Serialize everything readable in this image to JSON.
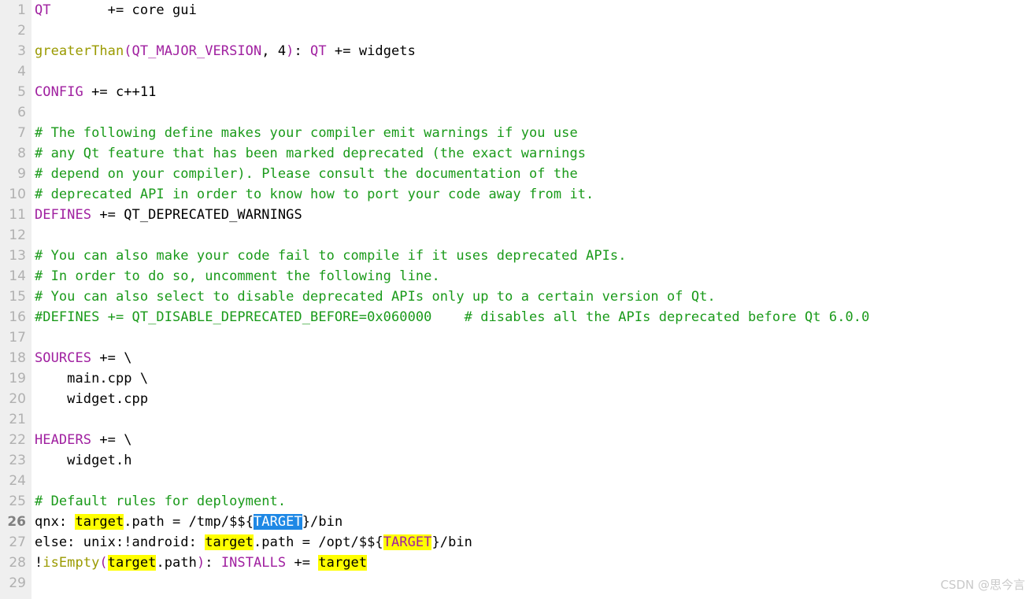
{
  "editor": {
    "language": "qmake-project",
    "colors": {
      "background": "#ffffff",
      "gutter_background": "#efefef",
      "line_number": "#b0b0b0",
      "line_number_current": "#808080",
      "text": "#000000",
      "comment": "#1a9a1a",
      "keyword": "#a020a0",
      "function": "#9a9a00",
      "find_highlight": "#ffff00",
      "selection_highlight": "#1e88e5",
      "selection_text": "#ffffff"
    },
    "current_line": 26,
    "selected_text": "TARGET",
    "find_term": "target",
    "lines": [
      {
        "n": "1",
        "tokens": [
          {
            "t": "QT",
            "c": "keyword"
          },
          {
            "t": "       += core gui",
            "c": "plain"
          }
        ]
      },
      {
        "n": "2",
        "tokens": [
          {
            "t": "",
            "c": "plain"
          }
        ]
      },
      {
        "n": "3",
        "tokens": [
          {
            "t": "greaterThan",
            "c": "func"
          },
          {
            "t": "(",
            "c": "punct"
          },
          {
            "t": "QT_MAJOR_VERSION",
            "c": "keyword"
          },
          {
            "t": ", 4",
            "c": "plain"
          },
          {
            "t": ")",
            "c": "punct"
          },
          {
            "t": ": ",
            "c": "plain"
          },
          {
            "t": "QT",
            "c": "keyword"
          },
          {
            "t": " += widgets",
            "c": "plain"
          }
        ]
      },
      {
        "n": "4",
        "tokens": [
          {
            "t": "",
            "c": "plain"
          }
        ]
      },
      {
        "n": "5",
        "tokens": [
          {
            "t": "CONFIG",
            "c": "keyword"
          },
          {
            "t": " += c++11",
            "c": "plain"
          }
        ]
      },
      {
        "n": "6",
        "tokens": [
          {
            "t": "",
            "c": "plain"
          }
        ]
      },
      {
        "n": "7",
        "tokens": [
          {
            "t": "# The following define makes your compiler emit warnings if you use",
            "c": "comment"
          }
        ]
      },
      {
        "n": "8",
        "tokens": [
          {
            "t": "# any Qt feature that has been marked deprecated (the exact warnings",
            "c": "comment"
          }
        ]
      },
      {
        "n": "9",
        "tokens": [
          {
            "t": "# depend on your compiler). Please consult the documentation of the",
            "c": "comment"
          }
        ]
      },
      {
        "n": "10",
        "tokens": [
          {
            "t": "# deprecated API in order to know how to port your code away from it.",
            "c": "comment"
          }
        ]
      },
      {
        "n": "11",
        "tokens": [
          {
            "t": "DEFINES",
            "c": "keyword"
          },
          {
            "t": " += QT_DEPRECATED_WARNINGS",
            "c": "plain"
          }
        ]
      },
      {
        "n": "12",
        "tokens": [
          {
            "t": "",
            "c": "plain"
          }
        ]
      },
      {
        "n": "13",
        "tokens": [
          {
            "t": "# You can also make your code fail to compile if it uses deprecated APIs.",
            "c": "comment"
          }
        ]
      },
      {
        "n": "14",
        "tokens": [
          {
            "t": "# In order to do so, uncomment the following line.",
            "c": "comment"
          }
        ]
      },
      {
        "n": "15",
        "tokens": [
          {
            "t": "# You can also select to disable deprecated APIs only up to a certain version of Qt.",
            "c": "comment"
          }
        ]
      },
      {
        "n": "16",
        "tokens": [
          {
            "t": "#DEFINES += QT_DISABLE_DEPRECATED_BEFORE=0x060000    # disables all the APIs deprecated before Qt 6.0.0",
            "c": "comment"
          }
        ]
      },
      {
        "n": "17",
        "tokens": [
          {
            "t": "",
            "c": "plain"
          }
        ]
      },
      {
        "n": "18",
        "tokens": [
          {
            "t": "SOURCES",
            "c": "keyword"
          },
          {
            "t": " += \\",
            "c": "plain"
          }
        ]
      },
      {
        "n": "19",
        "tokens": [
          {
            "t": "    main.cpp \\",
            "c": "plain"
          }
        ]
      },
      {
        "n": "20",
        "tokens": [
          {
            "t": "    widget.cpp",
            "c": "plain"
          }
        ]
      },
      {
        "n": "21",
        "tokens": [
          {
            "t": "",
            "c": "plain"
          }
        ]
      },
      {
        "n": "22",
        "tokens": [
          {
            "t": "HEADERS",
            "c": "keyword"
          },
          {
            "t": " += \\",
            "c": "plain"
          }
        ]
      },
      {
        "n": "23",
        "tokens": [
          {
            "t": "    widget.h",
            "c": "plain"
          }
        ]
      },
      {
        "n": "24",
        "tokens": [
          {
            "t": "",
            "c": "plain"
          }
        ]
      },
      {
        "n": "25",
        "tokens": [
          {
            "t": "# Default rules for deployment.",
            "c": "comment"
          }
        ]
      },
      {
        "n": "26",
        "tokens": [
          {
            "t": "qnx: ",
            "c": "plain"
          },
          {
            "t": "target",
            "c": "plain",
            "hl": "find"
          },
          {
            "t": ".path = /tmp/$${",
            "c": "plain"
          },
          {
            "t": "TARGET",
            "c": "plain",
            "hl": "select"
          },
          {
            "t": "}/bin",
            "c": "plain"
          }
        ]
      },
      {
        "n": "27",
        "tokens": [
          {
            "t": "else: unix:!android: ",
            "c": "plain"
          },
          {
            "t": "target",
            "c": "plain",
            "hl": "find"
          },
          {
            "t": ".path = /opt/$${",
            "c": "plain"
          },
          {
            "t": "TARGET",
            "c": "keyword",
            "hl": "find"
          },
          {
            "t": "}/bin",
            "c": "plain"
          }
        ]
      },
      {
        "n": "28",
        "tokens": [
          {
            "t": "!",
            "c": "plain"
          },
          {
            "t": "isEmpty",
            "c": "func"
          },
          {
            "t": "(",
            "c": "punct"
          },
          {
            "t": "target",
            "c": "plain",
            "hl": "find"
          },
          {
            "t": ".path",
            "c": "plain"
          },
          {
            "t": ")",
            "c": "punct"
          },
          {
            "t": ": ",
            "c": "plain"
          },
          {
            "t": "INSTALLS",
            "c": "keyword"
          },
          {
            "t": " += ",
            "c": "plain"
          },
          {
            "t": "target",
            "c": "plain",
            "hl": "find"
          }
        ]
      },
      {
        "n": "29",
        "tokens": [
          {
            "t": "",
            "c": "plain"
          }
        ]
      }
    ]
  },
  "watermark": {
    "text": "CSDN @思今言"
  }
}
